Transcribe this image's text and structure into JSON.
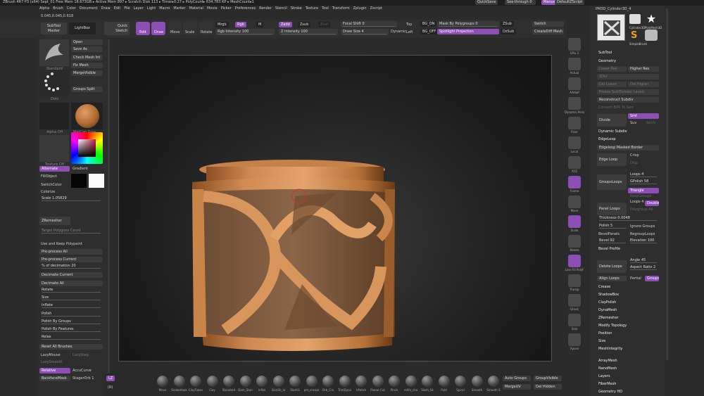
{
  "titlebar": {
    "text": "ZBrush 4R7 P3 (x64)    Sept_01    Free Mem 18.673GB ▸ Active Mem 897 ▸ Scratch Disk 113 ▸ Timer▸0.27 ▸ PolyCount▸ 634,783 KP ▸ MeshCount▸1",
    "quicksave": "QuickSave",
    "seethrough": "See-through  0",
    "menus": "Menus",
    "defaultscript": "DefaultZScript"
  },
  "menubar": [
    "Alpha",
    "Brush",
    "Color",
    "Document",
    "Draw",
    "Edit",
    "File",
    "Layer",
    "Light",
    "Macro",
    "Marker",
    "Material",
    "Movie",
    "Picker",
    "Preferences",
    "Render",
    "Stencil",
    "Stroke",
    "Texture",
    "Tool",
    "Transform",
    "Zplugin",
    "Zscript"
  ],
  "coords": "0.045,0.045,0.618",
  "toolbar": {
    "subtool_master": "SubTool Master",
    "lightbox": "LightBox",
    "quick_sketch": "Quick Sketch",
    "edit": "Edit",
    "draw": "Draw",
    "move": "Move",
    "scale": "Scale",
    "rotate": "Rotate",
    "mrgb": "Mrgb",
    "rgb": "Rgb",
    "m": "M",
    "rgb_intensity": "Rgb Intensity 100",
    "zadd": "Zadd",
    "zsub": "Zsub",
    "zcut": "Zcut",
    "z_intensity": "Z Intensity 100",
    "focal_shift": "Focal Shift 0",
    "draw_size": "Draw Size 4",
    "dynamic": "Dynamic",
    "mask_by_polygroups": "Mask By Polygroups 0",
    "spotlight_projection": "Spotlight Projection",
    "zsub2": "ZSub",
    "dzadd": "DzAdd",
    "dzsub": "DzSub",
    "switch": "Switch",
    "creatediff": "CreateDiff Mesh",
    "top": "Top",
    "left": "Left",
    "bg_on": "BG_ON",
    "bg_off": "BG_OFF"
  },
  "left_panel": {
    "open": "Open",
    "save_as": "Save As",
    "check_mesh_int": "Check Mesh Int",
    "fix_mesh": "Fix Mesh",
    "merge_visible": "MergeVisible",
    "groups_split": "Groups Split",
    "brush_label": "Standard",
    "stroke_label": "Dots",
    "alpha_label": "Alpha Off",
    "texture_label": "Texture Off",
    "material_label": "MatCap Gray",
    "alternate": "Alternate",
    "gradient": "Gradient",
    "fill_object": "FillObject",
    "switch_color": "SwitchColor",
    "colorize": "Colorize",
    "scale": "Scale 1.05829",
    "zremesher": "ZRemesher",
    "target_polygons": "Target Polygons Count",
    "use_keep_polypaint": "Use and Keep Polypaint",
    "preprocess_all": "Pre-process All",
    "preprocess_current": "Pre-process Current",
    "pct_decimation": "% of decimation 20",
    "decimate_current": "Decimate Current",
    "decimate_all": "Decimate All",
    "rotate": "Rotate",
    "size": "Size",
    "inflate": "Inflate",
    "polish": "Polish",
    "polish_by_groups": "Polish By Groups",
    "polish_by_features": "Polish By Features",
    "relax": "Relax",
    "reset_all_brushes": "Reset All Brushes",
    "lazymouse": "LazyMouse",
    "lazystep": "LazyStep",
    "lazysmooth": "LazySmooth",
    "relative": "Relative",
    "accucurve": "AccuCurve",
    "backfacemask": "BackfaceMask",
    "stagerorb": "StagerOrb 1"
  },
  "right_panel": {
    "tool_name": "PM3D_Cylinder3D_4",
    "cylinder_label": "Cylinder3D",
    "polymesh_label": "PolyMesh3D",
    "simplebrush_label": "SimpleBrush",
    "subtool": "SubTool",
    "geometry": "Geometry",
    "lower_res": "Lower Res",
    "higher_res": "Higher Res",
    "sdiv": "SDiv",
    "del_lower": "Del Lower",
    "del_higher": "Del Higher",
    "freeze_subdiv": "Freeze SubDivision Levels",
    "reconstruct_subdiv": "Reconstruct Subdiv",
    "convert_bpr": "Convert BPR To Geo",
    "divide": "Divide",
    "smt": "Smt",
    "suv": "Suv",
    "reuv": "ReUV",
    "dynamic_subdiv": "Dynamic Subdiv",
    "edgeloop": "EdgeLoop",
    "edgeloop_masked": "Edgeloop Masked Border",
    "edge_loop": "Edge Loop",
    "crisp": "Crisp",
    "disp": "Disp",
    "groupsloops": "GroupsLoops",
    "loops": "Loops 4",
    "gpolish": "GPolish 58",
    "triangle": "Triangle",
    "keepgroups": "KeepGroups",
    "panel_loops": "Panel Loops",
    "double": "Double",
    "polygroup_all": "Polygroup All",
    "thickness": "Thickness 0.0048",
    "polish": "Polish 5",
    "ignore_groups": "Ignore Groups",
    "bevel_panels": "BevelPanels",
    "regroup_loops": "RegroupLoops",
    "bevel": "Bevel 92",
    "elevation": "Elevation 100",
    "bevel_profile": "Bevel Profile",
    "angle": "Angle 45",
    "delete_loops": "Delete Loops",
    "aspect_ratio": "Aspect Ratio 2",
    "align_loops": "Align Loops",
    "partial": "Partial",
    "groups": "Groups",
    "crease": "Crease",
    "shadowbox": "ShadowBox",
    "claypolish": "ClayPolish",
    "dynamesh": "DynaMesh",
    "zremesher": "ZRemesher",
    "modify_topology": "Modify Topology",
    "position": "Position",
    "size": "Size",
    "meshintegrity": "MeshIntegrity",
    "arraymesh": "ArrayMesh",
    "nanomesh": "NanoMesh",
    "layers": "Layers",
    "fibermesh": "FiberMesh",
    "geometry_hd": "Geometry HD"
  },
  "right_shelf": [
    "SPix 3",
    "Actual",
    "AAHalf",
    "Dynamic Persp",
    "Floor",
    "Local",
    "XYZ",
    "Frame",
    "Move",
    "Scale",
    "Rotate",
    "Line Fill PolyF",
    "Transp",
    "Ghost",
    "Solo",
    "Xpose"
  ],
  "bottom_bar": {
    "lazy": "LZ",
    "r": "(R)",
    "brushes": [
      "Move",
      "SnakeHook",
      "ClayTubes",
      "Clay",
      "Standard",
      "Dam_Stan",
      "Inflat",
      "SkinSh_lo",
      "Slash3",
      "pm_crease",
      "Orb_Cra",
      "TrimDyna",
      "hPolish",
      "Planar Cut",
      "Pinch",
      "mAhi_cho",
      "Slash_Sk",
      "Fold",
      "Spiral",
      "Smooth",
      "Smooth S"
    ],
    "auto_groups": "Auto Groups",
    "group_visible": "GroupVisible",
    "delhidden": "Del Hidden",
    "mergeuv": "MergeUV"
  }
}
